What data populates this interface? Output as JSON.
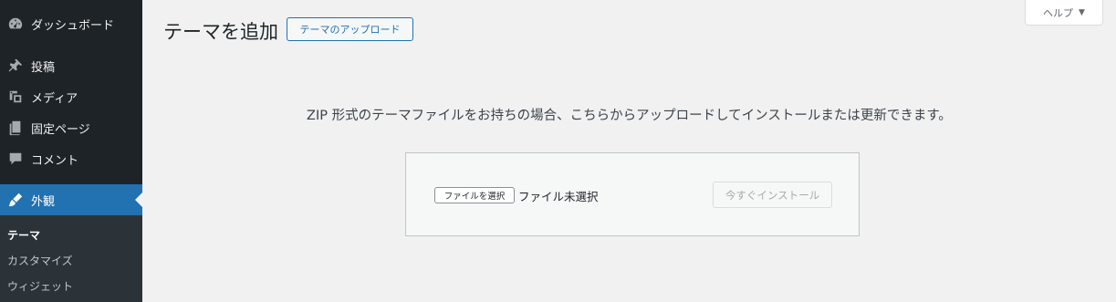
{
  "sidebar": {
    "items": [
      {
        "label": "ダッシュボード",
        "icon": "dashboard-icon"
      },
      {
        "label": "投稿",
        "icon": "pin-icon"
      },
      {
        "label": "メディア",
        "icon": "media-icon"
      },
      {
        "label": "固定ページ",
        "icon": "page-icon"
      },
      {
        "label": "コメント",
        "icon": "comment-icon"
      },
      {
        "label": "外観",
        "icon": "appearance-icon",
        "current": true
      }
    ],
    "submenu": [
      {
        "label": "テーマ",
        "current": true
      },
      {
        "label": "カスタマイズ"
      },
      {
        "label": "ウィジェット"
      }
    ]
  },
  "header": {
    "title": "テーマを追加",
    "upload_button": "テーマのアップロード",
    "help_tab": "ヘルプ"
  },
  "main": {
    "description": "ZIP 形式のテーマファイルをお持ちの場合、こちらからアップロードしてインストールまたは更新できます。",
    "file_button": "ファイルを選択",
    "file_status": "ファイル未選択",
    "install_button": "今すぐインストール"
  },
  "colors": {
    "sidebar_bg": "#1d2327",
    "accent": "#2271b1",
    "page_bg": "#f1f1f1"
  }
}
